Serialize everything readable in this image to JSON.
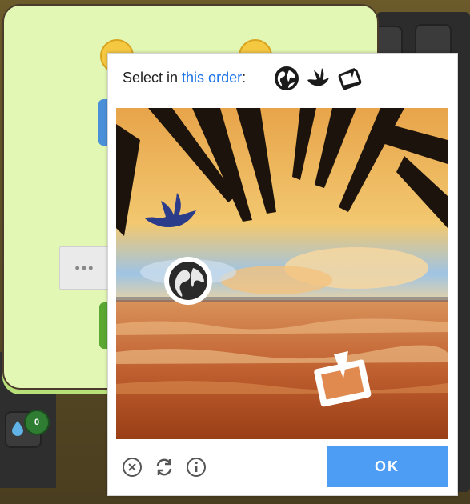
{
  "captcha": {
    "prompt_prefix": "Select in ",
    "prompt_link": "this order",
    "prompt_suffix": ":",
    "order_icons": [
      "globe-icon",
      "bird-icon",
      "tablet-icon"
    ],
    "tiles": [
      "bird-icon",
      "globe-icon",
      "tablet-icon"
    ],
    "footer_icons": [
      "close-circle-icon",
      "refresh-icon",
      "info-icon"
    ],
    "ok_label": "OK",
    "accent": "#4d9df5",
    "link_color": "#1a73e8"
  },
  "background": {
    "dots_label": "•••",
    "drop_badge_count": "0",
    "modal_color": "#e3f7b4"
  }
}
